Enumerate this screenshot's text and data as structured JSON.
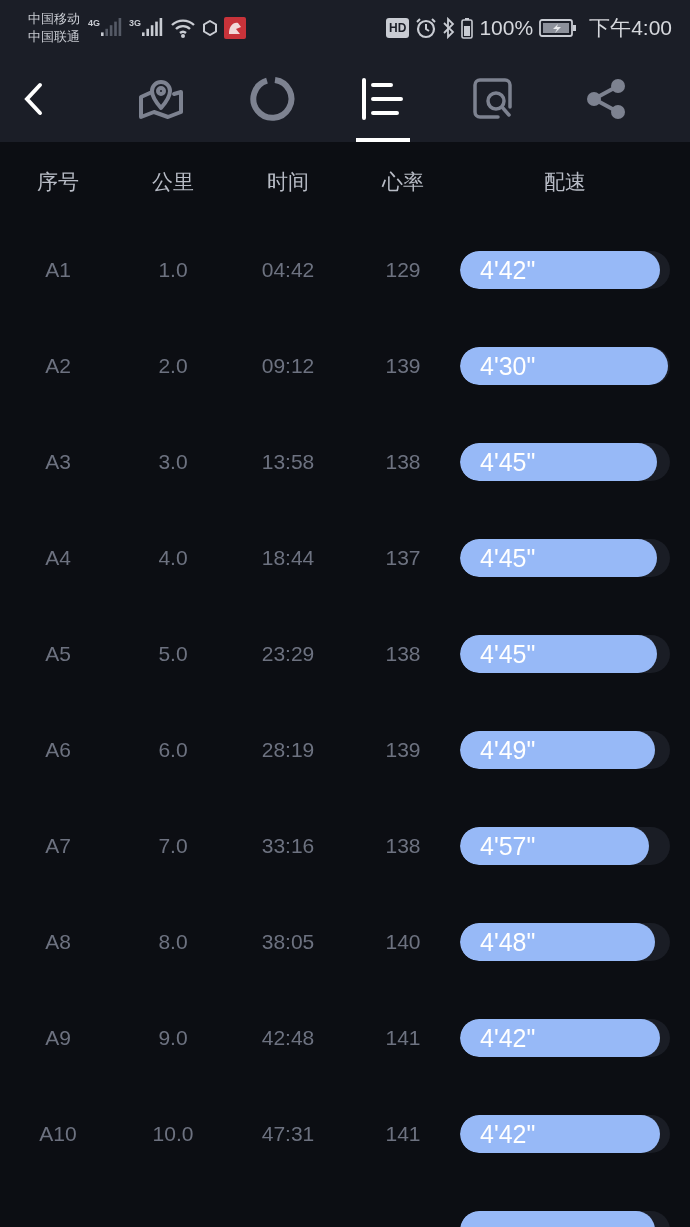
{
  "status_bar": {
    "carriers": [
      "中国移动",
      "中国联通"
    ],
    "network_labels": [
      "4G",
      "3G"
    ],
    "hd_badge": "HD",
    "battery": "100%",
    "time": "下午4:00"
  },
  "toolbar": {
    "tabs": [
      {
        "kind": "route",
        "selected": false
      },
      {
        "kind": "ring",
        "selected": false
      },
      {
        "kind": "splits",
        "selected": true
      },
      {
        "kind": "analysis",
        "selected": false
      },
      {
        "kind": "share",
        "selected": false
      }
    ]
  },
  "table": {
    "columns": [
      "序号",
      "公里",
      "时间",
      "心率",
      "配速"
    ],
    "rows": [
      {
        "index": "A1",
        "km": "1.0",
        "time": "04:42",
        "heart_rate": "129",
        "pace": "4'42\"",
        "level": 0.95
      },
      {
        "index": "A2",
        "km": "2.0",
        "time": "09:12",
        "heart_rate": "139",
        "pace": "4'30\"",
        "level": 0.99
      },
      {
        "index": "A3",
        "km": "3.0",
        "time": "13:58",
        "heart_rate": "138",
        "pace": "4'45\"",
        "level": 0.94
      },
      {
        "index": "A4",
        "km": "4.0",
        "time": "18:44",
        "heart_rate": "137",
        "pace": "4'45\"",
        "level": 0.94
      },
      {
        "index": "A5",
        "km": "5.0",
        "time": "23:29",
        "heart_rate": "138",
        "pace": "4'45\"",
        "level": 0.94
      },
      {
        "index": "A6",
        "km": "6.0",
        "time": "28:19",
        "heart_rate": "139",
        "pace": "4'49\"",
        "level": 0.93
      },
      {
        "index": "A7",
        "km": "7.0",
        "time": "33:16",
        "heart_rate": "138",
        "pace": "4'57\"",
        "level": 0.9
      },
      {
        "index": "A8",
        "km": "8.0",
        "time": "38:05",
        "heart_rate": "140",
        "pace": "4'48\"",
        "level": 0.93
      },
      {
        "index": "A9",
        "km": "9.0",
        "time": "42:48",
        "heart_rate": "141",
        "pace": "4'42\"",
        "level": 0.95
      },
      {
        "index": "A10",
        "km": "10.0",
        "time": "47:31",
        "heart_rate": "141",
        "pace": "4'42\"",
        "level": 0.95
      },
      {
        "level": 0.93
      }
    ]
  }
}
